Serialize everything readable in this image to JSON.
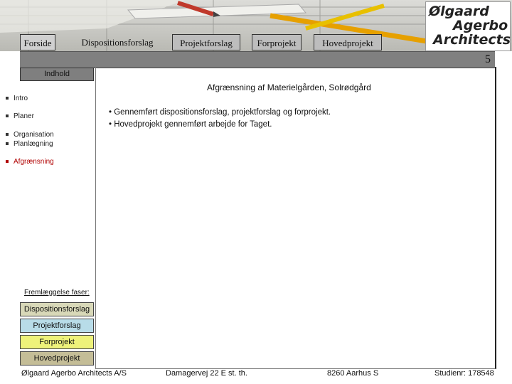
{
  "header": {
    "logo_lines": [
      "Ølgaard",
      "Agerbo",
      "Architects"
    ],
    "nav": [
      "Forside",
      "Dispositionsforslag",
      "Projektforslag",
      "Forprojekt",
      "Hovedprojekt"
    ],
    "page_number": "5"
  },
  "sidebar": {
    "heading": "Indhold",
    "items": [
      {
        "label": "Intro"
      },
      {
        "label": "Planer"
      },
      {
        "label": "Organisation"
      },
      {
        "label": "Planlægning"
      },
      {
        "label": "Afgrænsning",
        "active": true
      }
    ],
    "phases_title": "Fremlæggelse faser:",
    "phases": [
      "Dispositionsforslag",
      "Projektforslag",
      "Forprojekt",
      "Hovedprojekt"
    ]
  },
  "main": {
    "title": "Afgrænsning af Materielgården, Solrødgård",
    "bullets": [
      "• Gennemført dispositionsforslag, projektforslag og forprojekt.",
      "• Hovedprojekt gennemført arbejde for Taget."
    ]
  },
  "footer": {
    "company": "Ølgaard Agerbo Architects A/S",
    "address": "Damagervej 22 E st. th.",
    "city": "8260 Aarhus S",
    "student": "Studienr: 178548"
  },
  "colors": {
    "active_menu": "#b00000",
    "phase_dispositionsforslag": "#d8d8b8",
    "phase_projektforslag": "#b8dce8",
    "phase_forprojekt": "#eef27a",
    "phase_hovedprojekt": "#c4bd97"
  }
}
